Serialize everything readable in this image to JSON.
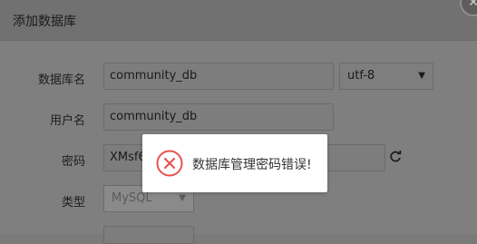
{
  "dialog": {
    "title": "添加数据库",
    "close_icon": "close-icon"
  },
  "form": {
    "db_name": {
      "label": "数据库名",
      "value": "community_db"
    },
    "charset": {
      "value": "utf-8"
    },
    "username": {
      "label": "用户名",
      "value": "community_db"
    },
    "password": {
      "label": "密码",
      "value": "XMsf6",
      "refresh_icon": "refresh-icon"
    },
    "type": {
      "label": "类型",
      "value": "MySQL"
    }
  },
  "toast": {
    "icon": "error-circle-icon",
    "message": "数据库管理密码错误!",
    "accent": "#e8534f"
  }
}
